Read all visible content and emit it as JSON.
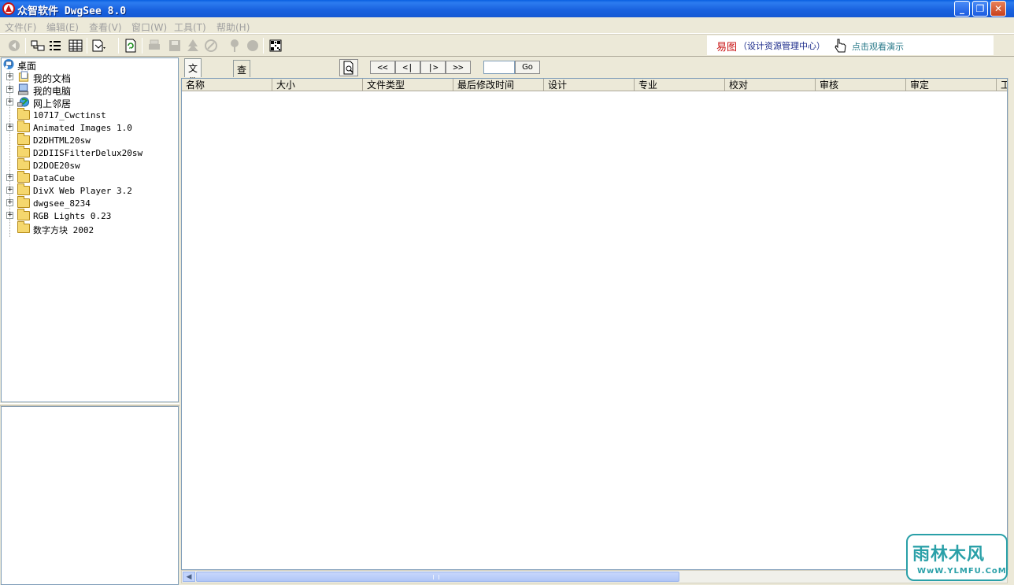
{
  "window": {
    "title": "众智软件 DwgSee 8.0",
    "min_glyph": "_",
    "max_glyph": "❐",
    "close_glyph": "✕"
  },
  "menu": [
    "文件(F)",
    "编辑(E)",
    "查看(V)",
    "窗口(W)",
    "工具(T)",
    "帮助(H)"
  ],
  "toolbar": {
    "buttons": [
      "back-icon",
      "map-drive-icon",
      "list-view-icon",
      "details-view-icon",
      "file-type-filter-icon",
      "refresh-icon",
      "print-icon",
      "save-icon",
      "tree-icon",
      "stamp-icon",
      "pin-icon",
      "circle-icon",
      "qrcode-icon"
    ],
    "ad": {
      "brand": "易图",
      "brand_sub": "（设计资源管理中心）",
      "demo_link": "点击观看演示"
    }
  },
  "tree": {
    "root": "桌面",
    "items": [
      {
        "label": "我的文档",
        "expandable": true,
        "icon": "my-documents-icon"
      },
      {
        "label": "我的电脑",
        "expandable": true,
        "icon": "my-computer-icon"
      },
      {
        "label": "网上邻居",
        "expandable": true,
        "icon": "network-icon"
      },
      {
        "label": "10717_Cwctinst",
        "expandable": false,
        "icon": "folder-icon"
      },
      {
        "label": "Animated Images 1.0",
        "expandable": true,
        "icon": "folder-icon"
      },
      {
        "label": "D2DHTML20sw",
        "expandable": false,
        "icon": "folder-icon"
      },
      {
        "label": "D2DIISFilterDelux20sw",
        "expandable": false,
        "icon": "folder-icon"
      },
      {
        "label": "D2DOE20sw",
        "expandable": false,
        "icon": "folder-icon"
      },
      {
        "label": "DataCube",
        "expandable": true,
        "icon": "folder-icon"
      },
      {
        "label": "DivX Web Player 3.2",
        "expandable": true,
        "icon": "folder-icon"
      },
      {
        "label": "dwgsee_8234",
        "expandable": true,
        "icon": "folder-icon"
      },
      {
        "label": "RGB Lights 0.23",
        "expandable": true,
        "icon": "folder-icon"
      },
      {
        "label": "数字方块 2002",
        "expandable": false,
        "icon": "folder-icon"
      }
    ]
  },
  "tabs": [
    "文件列表",
    "查询结果"
  ],
  "nav": {
    "first": "<<",
    "prev": "<|",
    "next": "|>",
    "last": ">>",
    "page_value": "",
    "go": "Go"
  },
  "columns": [
    "名称",
    "大小",
    "文件类型",
    "最后修改时间",
    "设计",
    "专业",
    "校对",
    "审核",
    "审定",
    "工"
  ],
  "watermark": {
    "logo": "雨林木风",
    "url": "WwW.YLMFU.CoM"
  }
}
